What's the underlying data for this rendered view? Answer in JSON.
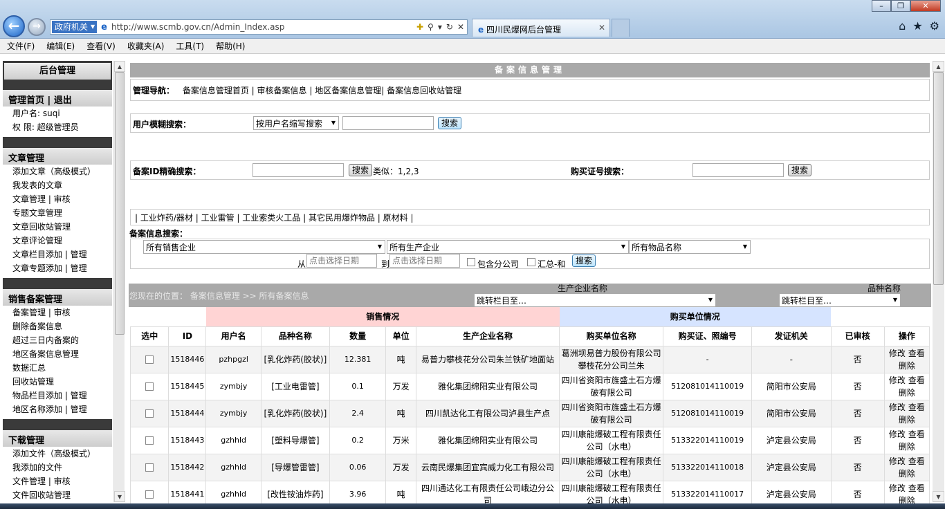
{
  "browser": {
    "zone_label": "政府机关",
    "url": "http://www.scmb.gov.cn/Admin_Index.asp",
    "tab_title": "四川民爆网后台管理",
    "menu": [
      "文件(F)",
      "编辑(E)",
      "查看(V)",
      "收藏夹(A)",
      "工具(T)",
      "帮助(H)"
    ]
  },
  "sidebar": {
    "title": "后台管理",
    "top_links": [
      "管理首页",
      "退出"
    ],
    "user_label": "用户名: suqi",
    "perm_label": "权  限: 超级管理员",
    "sections": [
      {
        "head": "文章管理",
        "items": [
          "添加文章（高级模式）",
          "我发表的文章",
          "文章管理 | 审核",
          "专题文章管理",
          "文章回收站管理",
          "文章评论管理",
          "文章栏目添加 | 管理",
          "文章专题添加 | 管理"
        ]
      },
      {
        "head": "销售备案管理",
        "items": [
          "备案管理 | 审核",
          "删除备案信息",
          "超过三日内备案的",
          "地区备案信息管理",
          "数据汇总",
          "回收站管理",
          "物品栏目添加 | 管理",
          "地区名称添加 | 管理"
        ]
      },
      {
        "head": "下载管理",
        "items": [
          "添加文件（高级模式）",
          "我添加的文件",
          "文件管理 | 审核",
          "文件回收站管理"
        ]
      }
    ]
  },
  "main": {
    "page_title": "备案信息管理",
    "nav_label": "管理导航：",
    "nav_links": [
      "备案信息管理首页",
      "审核备案信息",
      "地区备案信息管理",
      "备案信息回收站管理"
    ],
    "fuzzy_label": "用户模糊搜索：",
    "fuzzy_select": "按用户名缩写搜索",
    "search_btn": "搜索",
    "id_label": "备案ID精确搜索：",
    "id_hint": "类似：1,2,3",
    "cert_label": "购买证号搜索：",
    "categories": [
      "工业炸药/器材",
      "工业雷管",
      "工业索类火工品",
      "其它民用爆炸物品",
      "原材料"
    ],
    "info_label": "备案信息搜索：",
    "sel_sales": "所有销售企业",
    "sel_prod": "所有生产企业",
    "sel_item": "所有物品名称",
    "from_label": "从",
    "to_label": "到",
    "date_placeholder": "点击选择日期",
    "chk_branch": "包含分公司",
    "chk_sum": "汇总-和",
    "location": "您现在的位置：  备案信息管理 >> 所有备案信息",
    "prod_label": "生产企业名称",
    "item_label": "品种名称",
    "jump_text": "跳转栏目至…"
  },
  "table": {
    "group_sales": "销售情况",
    "group_buyer": "购买单位情况",
    "headers": [
      "选中",
      "ID",
      "用户名",
      "品种名称",
      "数量",
      "单位",
      "生产企业名称",
      "购买单位名称",
      "购买证、照编号",
      "发证机关",
      "已审核",
      "操作"
    ],
    "rows": [
      {
        "id": "1518446",
        "user": "pzhpgzl",
        "item": "[乳化炸药(胶状)]",
        "qty": "12.381",
        "unit": "吨",
        "producer": "易普力攀枝花分公司朱兰铁矿地面站",
        "buyer": "葛洲坝易普力股份有限公司攀枝花分公司兰朱",
        "cert": "-",
        "org": "-",
        "audited": "否"
      },
      {
        "id": "1518445",
        "user": "zymbjy",
        "item": "[工业电雷管]",
        "qty": "0.1",
        "unit": "万发",
        "producer": "雅化集团绵阳实业有限公司",
        "buyer": "四川省资阳市旌盛土石方爆破有限公司",
        "cert": "512081014110019",
        "org": "简阳市公安局",
        "audited": "否"
      },
      {
        "id": "1518444",
        "user": "zymbjy",
        "item": "[乳化炸药(胶状)]",
        "qty": "2.4",
        "unit": "吨",
        "producer": "四川凯达化工有限公司泸县生产点",
        "buyer": "四川省资阳市旌盛土石方爆破有限公司",
        "cert": "512081014110019",
        "org": "简阳市公安局",
        "audited": "否"
      },
      {
        "id": "1518443",
        "user": "gzhhld",
        "item": "[塑料导爆管]",
        "qty": "0.2",
        "unit": "万米",
        "producer": "雅化集团绵阳实业有限公司",
        "buyer": "四川康能爆破工程有限责任公司（水电）",
        "cert": "513322014110019",
        "org": "泸定县公安局",
        "audited": "否"
      },
      {
        "id": "1518442",
        "user": "gzhhld",
        "item": "[导爆管雷管]",
        "qty": "0.06",
        "unit": "万发",
        "producer": "云南民爆集团宜宾威力化工有限公司",
        "buyer": "四川康能爆破工程有限责任公司（水电）",
        "cert": "513322014110018",
        "org": "泸定县公安局",
        "audited": "否"
      },
      {
        "id": "1518441",
        "user": "gzhhld",
        "item": "[改性铵油炸药]",
        "qty": "3.96",
        "unit": "吨",
        "producer": "四川通达化工有限责任公司峨边分公司",
        "buyer": "四川康能爆破工程有限责任公司（水电）",
        "cert": "513322014110017",
        "org": "泸定县公安局",
        "audited": "否"
      }
    ],
    "op_edit": "修改",
    "op_view": "查看",
    "op_delete": "删除"
  }
}
